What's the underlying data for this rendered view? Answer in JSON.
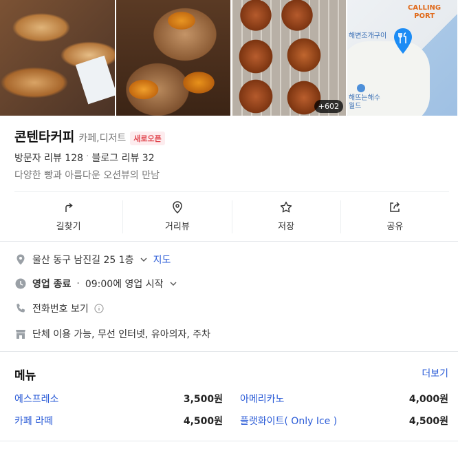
{
  "photos": {
    "more_count": "+602",
    "map": {
      "title_line1": "CALLING",
      "title_line2": "PORT",
      "label_restaurant": "해변조개구이",
      "label_place_line1": "해뜨는해수",
      "label_place_line2": "월드"
    }
  },
  "place": {
    "name": "콘텐타커피",
    "category": "카페,디저트",
    "badge": "새로오픈",
    "visitor_reviews": "방문자 리뷰 128",
    "blog_reviews": "블로그 리뷰 32",
    "description": "다양한 빵과 아름다운 오션뷰의 만남"
  },
  "actions": [
    {
      "label": "길찾기",
      "icon": "directions-icon"
    },
    {
      "label": "거리뷰",
      "icon": "location-pin-icon"
    },
    {
      "label": "저장",
      "icon": "star-icon"
    },
    {
      "label": "공유",
      "icon": "share-icon"
    }
  ],
  "info": {
    "address": "울산 동구 남진길 25 1층",
    "map_link": "지도",
    "status": "영업 종료",
    "hours": "09:00에 영업 시작",
    "phone": "전화번호 보기",
    "amenities": "단체 이용 가능, 무선 인터넷, 유아의자, 주차"
  },
  "menu": {
    "title": "메뉴",
    "more": "더보기",
    "items": [
      {
        "name": "에스프레소",
        "price": "3,500원"
      },
      {
        "name": "아메리카노",
        "price": "4,000원"
      },
      {
        "name": "카페 라떼",
        "price": "4,500원"
      },
      {
        "name": "플랫화이트( Only Ice )",
        "price": "4,500원"
      }
    ]
  },
  "colors": {
    "link": "#2a5bd7",
    "badge_text": "#e0434b",
    "map_pin": "#1c8cf5"
  }
}
